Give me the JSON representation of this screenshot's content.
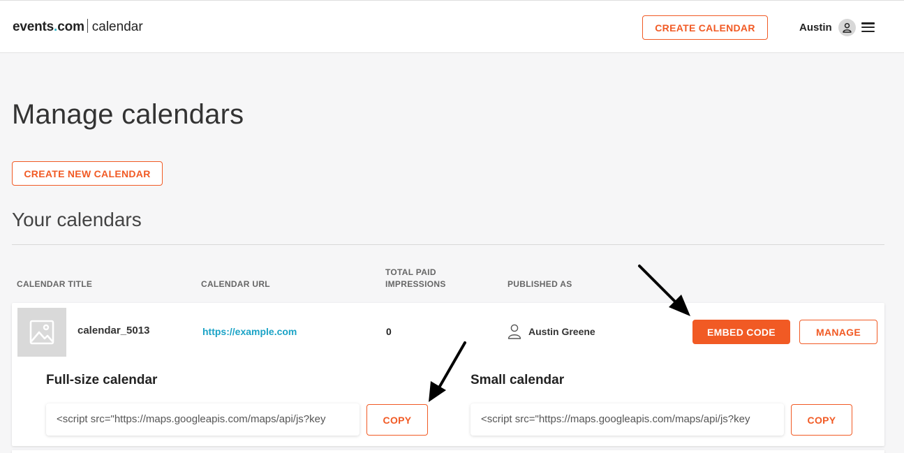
{
  "header": {
    "logo_brand": "events",
    "logo_dot": ".",
    "logo_tld": "com",
    "logo_product": "calendar",
    "create_calendar_label": "CREATE CALENDAR",
    "username": "Austin",
    "icons": {
      "avatar": "user-icon",
      "menu": "hamburger-menu-icon"
    }
  },
  "main": {
    "page_title": "Manage calendars",
    "create_new_label": "CREATE NEW CALENDAR",
    "section_title": "Your calendars"
  },
  "table": {
    "columns": {
      "title": "CALENDAR TITLE",
      "url": "CALENDAR URL",
      "impressions_line1": "TOTAL PAID",
      "impressions_line2": "IMPRESSIONS",
      "published": "PUBLISHED AS"
    },
    "rows": [
      {
        "title": "calendar_5013",
        "url": "https://example.com",
        "impressions": "0",
        "published_as": "Austin Greene",
        "embed_label": "EMBED CODE",
        "manage_label": "MANAGE",
        "embed": {
          "full_title": "Full-size calendar",
          "full_code": "<script src=\"https://maps.googleapis.com/maps/api/js?key",
          "small_title": "Small calendar",
          "small_code": "<script src=\"https://maps.googleapis.com/maps/api/js?key",
          "copy_label": "COPY"
        }
      }
    ]
  },
  "colors": {
    "accent": "#f15a24",
    "link": "#1ba3c6",
    "background": "#f6f6f7"
  }
}
